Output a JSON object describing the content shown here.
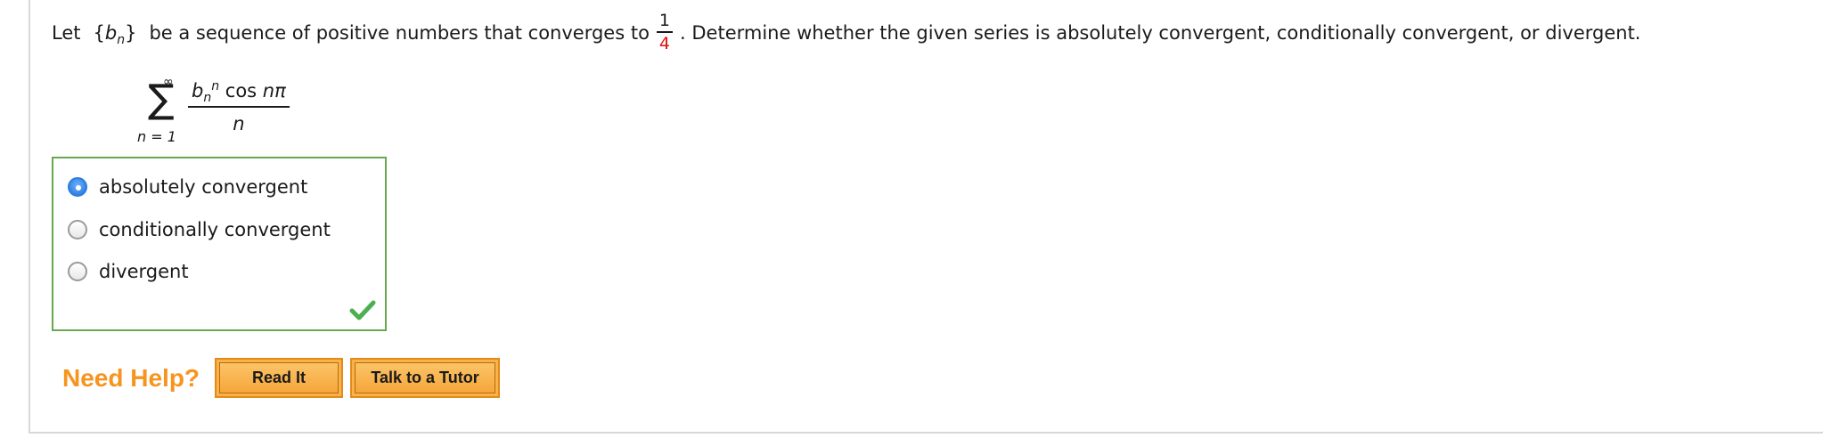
{
  "question": {
    "prefix": "Let",
    "seq_open": "{",
    "seq_var": "b",
    "seq_sub": "n",
    "seq_close": "}",
    "text_after_seq": "be a sequence of positive numbers that converges to",
    "limit_numerator": "1",
    "limit_denominator": "4",
    "text_end": ". Determine whether the given series is absolutely convergent, conditionally convergent, or divergent."
  },
  "series": {
    "upper_limit": "∞",
    "sigma": "∑",
    "lower_limit": "n = 1",
    "numerator_base": "b",
    "numerator_sub": "n",
    "numerator_sup": "n",
    "numerator_rest": " cos ",
    "numerator_arg": "nπ",
    "denominator": "n"
  },
  "choices": {
    "selected_index": 0,
    "options": [
      {
        "label": "absolutely convergent",
        "checked": true
      },
      {
        "label": "conditionally convergent",
        "checked": false
      },
      {
        "label": "divergent",
        "checked": false
      }
    ],
    "result_icon": "checkmark-icon",
    "correct_color": "#6aa84f"
  },
  "help": {
    "label": "Need Help?",
    "read_it": "Read It",
    "talk_to_tutor": "Talk to a Tutor",
    "accent_color": "#f7941d"
  }
}
